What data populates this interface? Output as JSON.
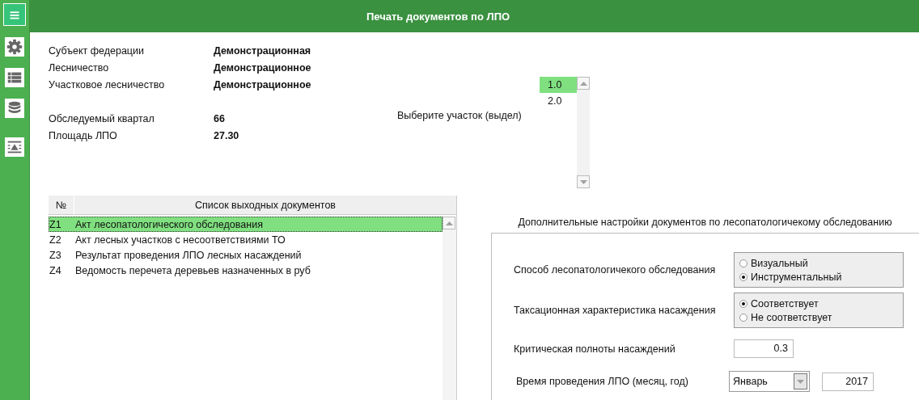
{
  "sidebar": {
    "items": [
      {
        "kind": "menu",
        "selected": true
      },
      {
        "kind": "settings",
        "selected": false
      },
      {
        "kind": "list",
        "selected": false
      },
      {
        "kind": "database",
        "selected": false
      },
      {
        "kind": "report",
        "selected": false
      }
    ]
  },
  "header": {
    "title": "Печать документов по ЛПО"
  },
  "info": {
    "groups": [
      [
        {
          "label": "Субъект федерации",
          "value": "Демонстрационная"
        },
        {
          "label": "Лесничество",
          "value": "Демонстрационное"
        },
        {
          "label": "Участковое лесничество",
          "value": "Демонстрационное"
        }
      ],
      [
        {
          "label": "Обследуемый квартал",
          "value": "66"
        },
        {
          "label": "Площадь ЛПО",
          "value": "27.30"
        }
      ]
    ]
  },
  "plot_selector": {
    "label": "Выберите участок (выдел)",
    "items": [
      {
        "label": "1.0",
        "selected": true
      },
      {
        "label": "2.0",
        "selected": false
      }
    ]
  },
  "documents": {
    "columns": [
      "№",
      "Список выходных документов"
    ],
    "rows": [
      {
        "code": "Z1",
        "title": "Акт лесопатологического обследования",
        "selected": true
      },
      {
        "code": "Z2",
        "title": "Акт лесных участков с несоответствиями ТО",
        "selected": false
      },
      {
        "code": "Z3",
        "title": "Результат проведения ЛПО лесных насаждений",
        "selected": false
      },
      {
        "code": "Z4",
        "title": "Ведомость перечета деревьев назначенных в руб",
        "selected": false
      }
    ]
  },
  "settings": {
    "title": "Дополнительные настройки документов по лесопатологичекому обследованию",
    "rows": [
      {
        "kind": "radio",
        "label": "Способ лесопатологичекого обследования",
        "options": [
          {
            "label": "Визуальный",
            "selected": false
          },
          {
            "label": "Инструментальный",
            "selected": true
          }
        ]
      },
      {
        "kind": "radio",
        "label": "Таксационная характеристика насаждения",
        "options": [
          {
            "label": "Соответствует",
            "selected": true
          },
          {
            "label": "Не соответствует",
            "selected": false
          }
        ]
      },
      {
        "kind": "number",
        "label": "Критическая полноты  насаждений",
        "value": "0.3"
      },
      {
        "kind": "month_year",
        "label": "Время проведения ЛПО  (месяц, год)",
        "month": "Январь",
        "year": "2017"
      }
    ]
  }
}
